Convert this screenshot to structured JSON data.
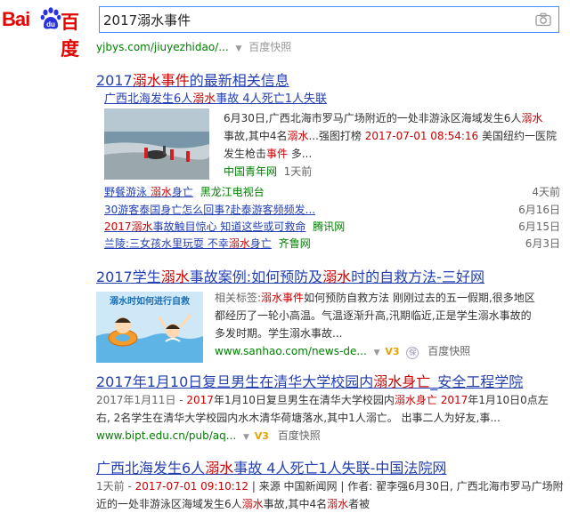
{
  "header": {
    "logo_latin": "Bai",
    "logo_paw_text": "du",
    "logo_cn": "百度",
    "search_value": "2017溺水事件"
  },
  "top_cut": {
    "url": "yjbys.com/jiuyezhidao/...",
    "cache": "百度快照"
  },
  "news_block": {
    "title_pre": "2017",
    "title_em": "溺水事件",
    "title_post": "的最新相关信息",
    "featured": {
      "title_pre": "广西北海发生6人",
      "title_em": "溺水",
      "title_post": "事故 4人死亡1人失联",
      "desc1": "6月30日,广西北海市罗马广场附近的一处非游泳区海域发生6人",
      "desc1_em": "溺水",
      "desc2a": "事故,其中4名",
      "desc2_em": "溺水",
      "desc2b": "...强图打榜 ",
      "desc2_date": "2017-07-01 08:54:16",
      "desc2c": " 美国纽约一医院",
      "desc3a": "发生枪击",
      "desc3_em": "事件",
      "desc3b": " 多...",
      "source": "中国青年网",
      "time": "1天前"
    },
    "items": [
      {
        "t_pre": "野餐游泳 ",
        "t_em": "溺水",
        "t_post": "身亡",
        "source": "黑龙江电视台",
        "date": "4天前"
      },
      {
        "t_pre": "30游客泰国身亡怎么回事?赴泰游客频频发...",
        "t_em": "",
        "t_post": "",
        "source": "",
        "date": "6月16日"
      },
      {
        "t_pre": "2017",
        "t_em": "溺水",
        "t_post": "事故触目惊心 知道这些或可救命",
        "source": "腾讯网",
        "date": "6月15日"
      },
      {
        "t_pre": "兰陵:三女孩水里玩耍 不幸",
        "t_em": "溺水",
        "t_post": "身亡",
        "source": "齐鲁网",
        "date": "6月3日"
      }
    ]
  },
  "result2": {
    "title_pre": "2017学生",
    "title_em1": "溺水",
    "title_mid": "事故案例:如何预防及",
    "title_em2": "溺水",
    "title_post": "时的自救方法-三好网",
    "image_caption": "溺水时如何进行自救",
    "desc1a": "相关标签:",
    "desc1_em": "溺水事件",
    "desc1b": "如何预防自救方法 刚刚过去的五一假期,很多地区",
    "desc2": "都经历了一轮小高温。气温逐渐升高,汛期临近,正是学生溺水事故的",
    "desc3": "多发时期。学生溺水事故...",
    "url": "www.sanhao.com/news-de...",
    "v3": "V3",
    "cache": "百度快照"
  },
  "result3": {
    "title_pre": "2017年1月10日复旦男生在清华大学校园内",
    "title_em": "溺水身亡",
    "title_post": "_安全工程学院",
    "date": "2017年1月11日 - ",
    "line1a": "2017",
    "line1b": "年1月10日复旦男生在清华大学校园内",
    "line1_em": "溺水身亡",
    "line1c": " ",
    "line1d": "2017",
    "line1e": "年1月10日0点左",
    "line2": "右, 2名学生在清华大学校园内水木清华荷塘落水,其中1人溺亡。 出事二人为好友,事...",
    "url": "www.bipt.edu.cn/pub/aq...",
    "v3": "V3",
    "cache": "百度快照"
  },
  "result4": {
    "title_pre": "广西北海发生6人",
    "title_em": "溺水",
    "title_post": "事故 4人死亡1人失联-中国法院网",
    "line1a": "1天前 - ",
    "line1_date": "2017-07-01 09:10:12",
    "line1b": " | 来源 中国新闻网 | 作者: 翟李强6月30日, 广西北海市罗马广场附",
    "line2a": "近的一处非游泳区海域发生6人",
    "line2_em": "溺水",
    "line2b": "事故,其中4名",
    "line2_em2": "溺水",
    "line2c": "者被"
  }
}
